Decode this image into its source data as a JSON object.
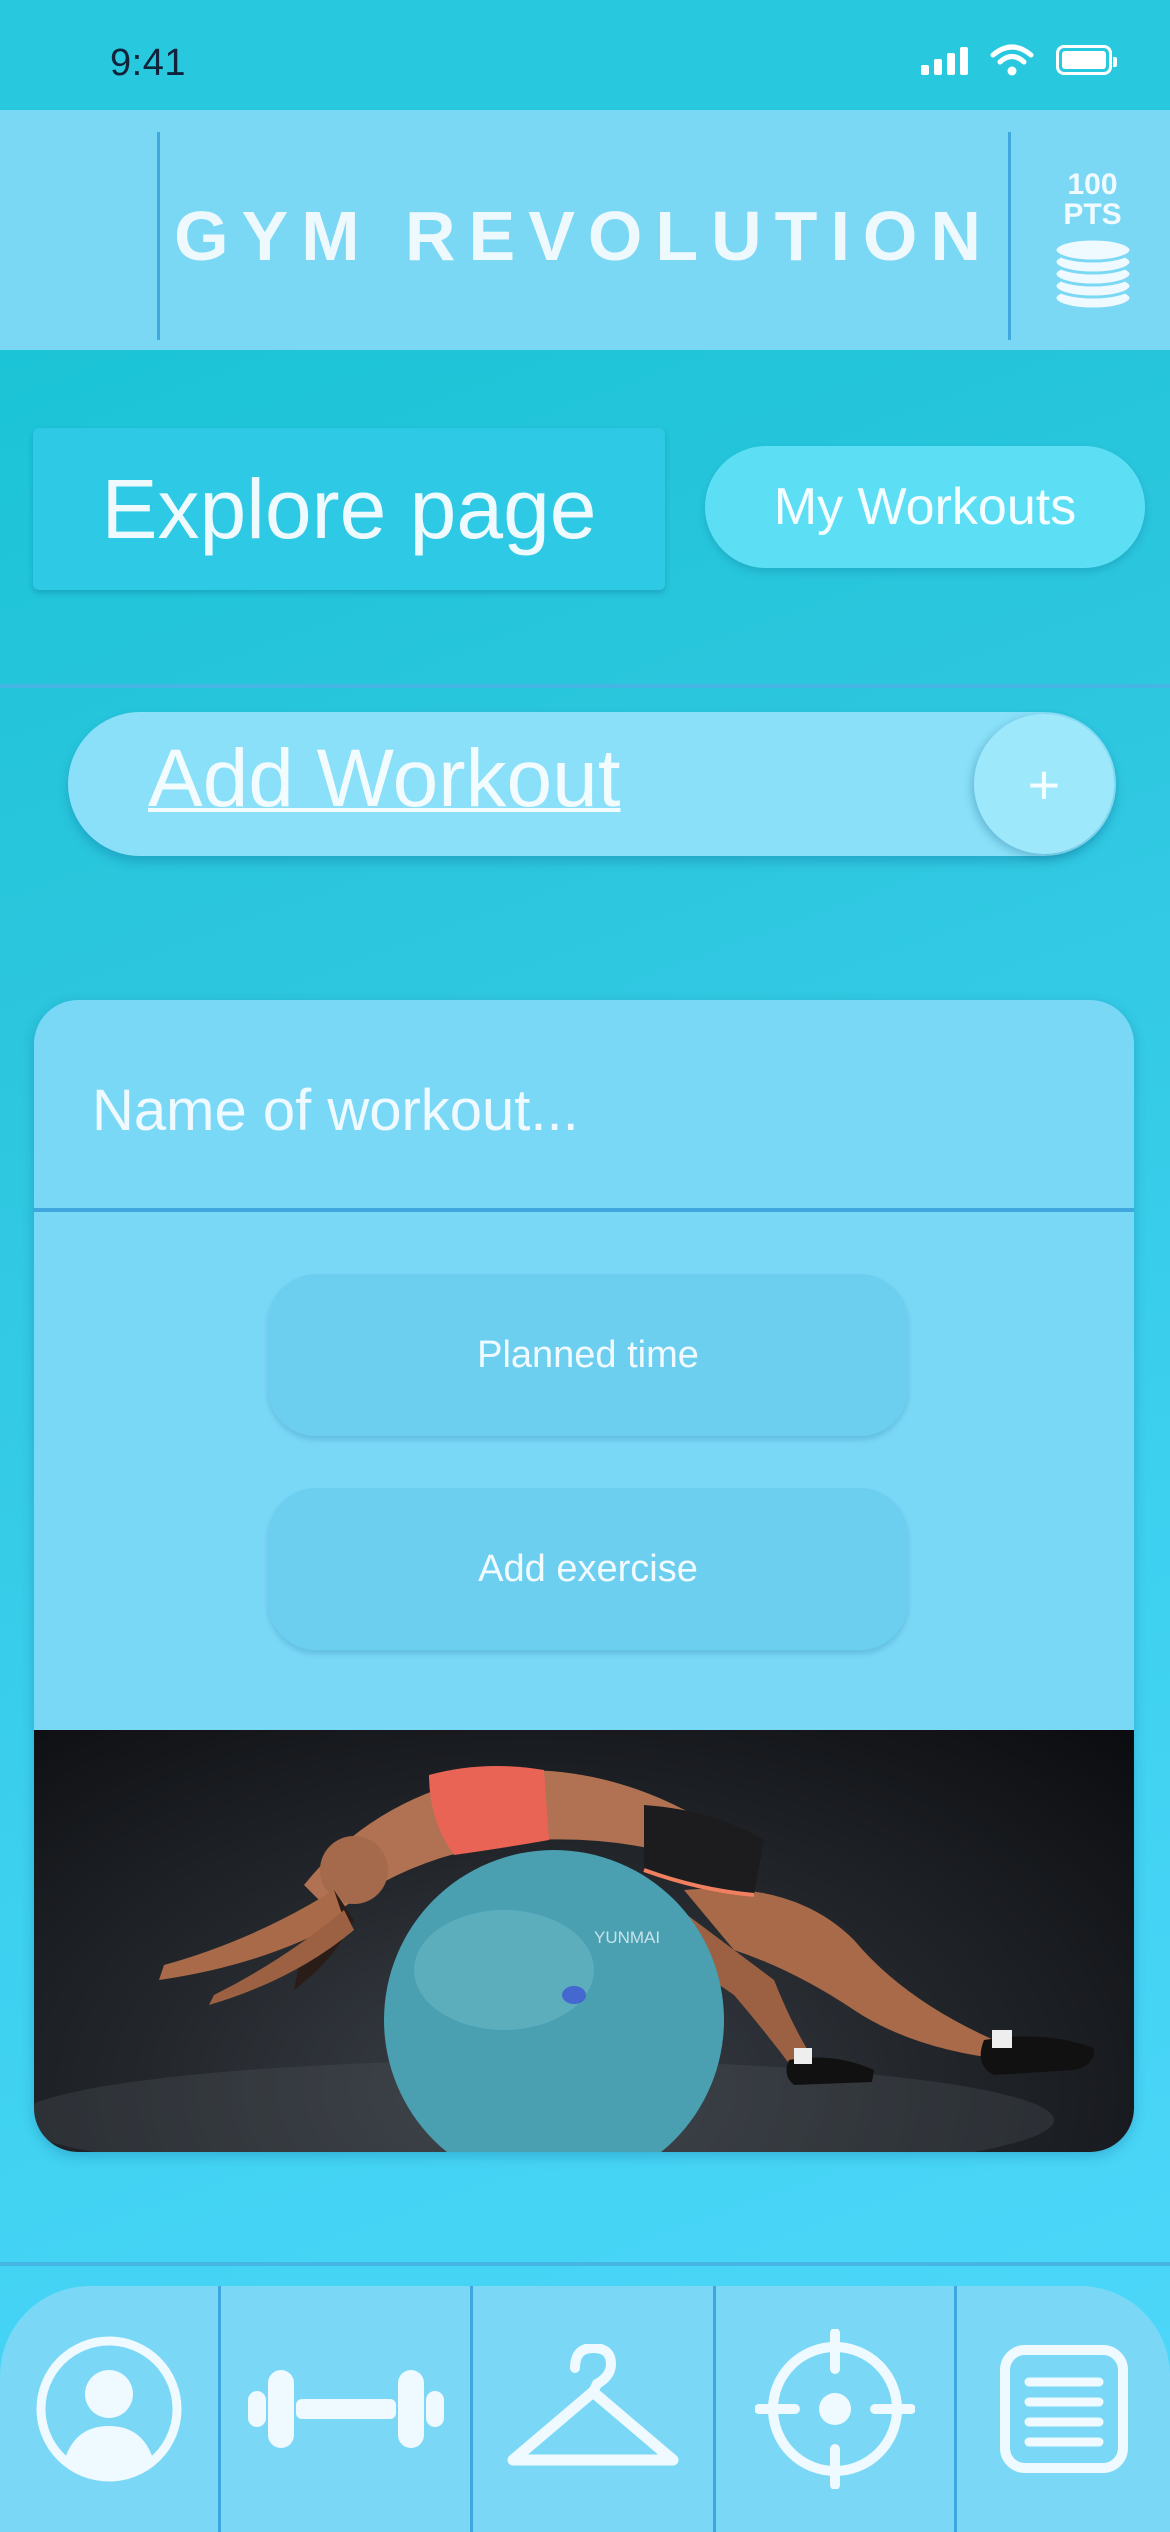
{
  "status_bar": {
    "time": "9:41"
  },
  "header": {
    "app_title": "GYM REVOLUTION",
    "points_value": "100",
    "points_label": "PTS"
  },
  "nav": {
    "explore_label": "Explore page",
    "workouts_label": "My Workouts"
  },
  "add_workout": {
    "label": "Add Workout",
    "plus": "+"
  },
  "workout_form": {
    "name_placeholder": "Name of workout...",
    "planned_time_label": "Planned time",
    "add_exercise_label": "Add exercise"
  },
  "photo": {
    "ball_brand": "YUNMAI"
  },
  "tabbar": {
    "items": [
      {
        "icon": "profile-icon"
      },
      {
        "icon": "dumbbell-icon"
      },
      {
        "icon": "hanger-icon"
      },
      {
        "icon": "target-icon"
      },
      {
        "icon": "notes-icon"
      }
    ]
  },
  "colors": {
    "background": "#2cc6de",
    "header": "#7ad8f4",
    "card": "#7ad8f7",
    "accent_line": "#3fa6de",
    "text": "#eefafe"
  }
}
